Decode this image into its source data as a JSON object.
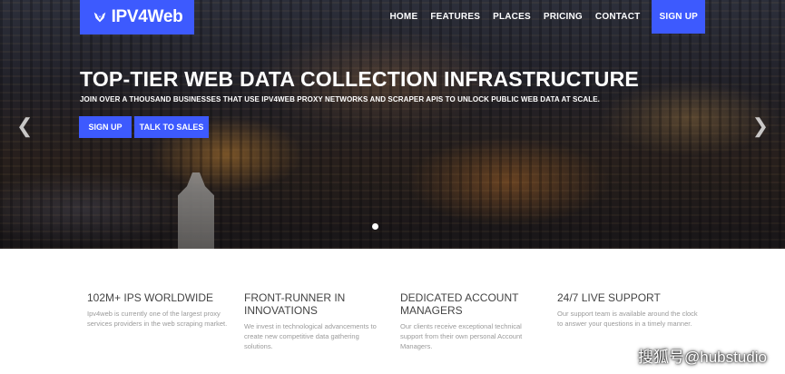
{
  "brand": {
    "logo_text": "IPV4Web",
    "accent": "#3d5afe"
  },
  "nav": {
    "items": [
      {
        "label": "HOME"
      },
      {
        "label": "FEATURES"
      },
      {
        "label": "PLACES"
      },
      {
        "label": "PRICING"
      },
      {
        "label": "CONTACT"
      }
    ],
    "signup_label": "SIGN UP"
  },
  "hero": {
    "title": "TOP-TIER WEB DATA COLLECTION INFRASTRUCTURE",
    "subtitle": "JOIN OVER A THOUSAND BUSINESSES THAT USE IPV4WEB PROXY NETWORKS AND SCRAPER APIS TO UNLOCK PUBLIC WEB DATA AT SCALE.",
    "primary_cta": "SIGN UP",
    "secondary_cta": "TALK TO SALES",
    "prev_icon": "chevron-left-icon",
    "next_icon": "chevron-right-icon"
  },
  "features": [
    {
      "title": "102M+ IPS WORLDWIDE",
      "body": "Ipv4web is currently one of the largest proxy services providers in the web scraping market."
    },
    {
      "title": "FRONT-RUNNER IN INNOVATIONS",
      "body": "We invest in technological advancements to create new competitive data gathering solutions."
    },
    {
      "title": "DEDICATED ACCOUNT MANAGERS",
      "body": "Our clients receive exceptional technical support from their own personal Account Managers."
    },
    {
      "title": "24/7 LIVE SUPPORT",
      "body": "Our support team is available around the clock to answer your questions in a timely manner."
    }
  ],
  "watermark": "搜狐号@hubstudio"
}
